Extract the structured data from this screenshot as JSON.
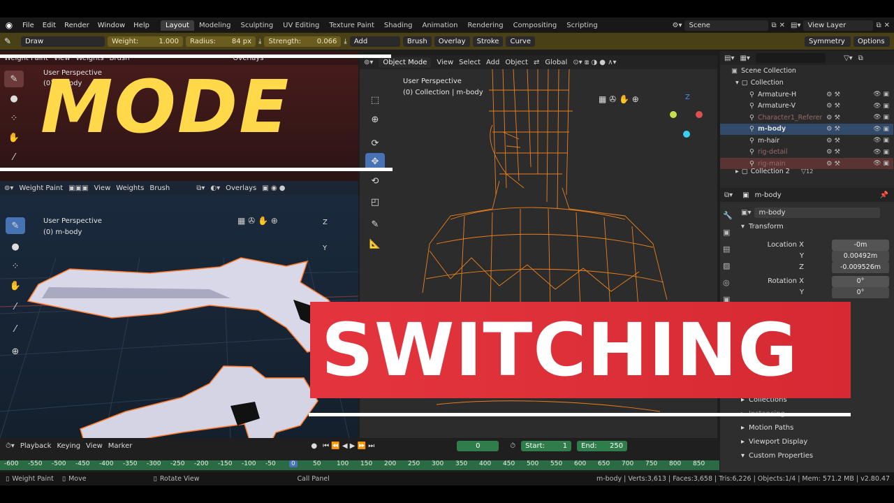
{
  "menu": {
    "items": [
      "File",
      "Edit",
      "Render",
      "Window",
      "Help"
    ],
    "workspaces": [
      "Layout",
      "Modeling",
      "Sculpting",
      "UV Editing",
      "Texture Paint",
      "Shading",
      "Animation",
      "Rendering",
      "Compositing",
      "Scripting"
    ],
    "active_workspace": "Layout",
    "scene": "Scene",
    "view_layer": "View Layer"
  },
  "tool_header": {
    "brush": "Draw",
    "weight_label": "Weight:",
    "weight_value": "1.000",
    "radius_label": "Radius:",
    "radius_value": "84 px",
    "strength_label": "Strength:",
    "strength_value": "0.066",
    "blend": "Add",
    "brush_menu": "Brush",
    "overlay_menu": "Overlay",
    "stroke_menu": "Stroke",
    "curve_menu": "Curve",
    "symmetry": "Symmetry",
    "options": "Options"
  },
  "viewport_top_left": {
    "mode": "Weight Paint",
    "menus": [
      "View",
      "Weights",
      "Brush"
    ],
    "overlays": "Overlays",
    "perspective": "User Perspective",
    "collection": "(0) m-body"
  },
  "viewport_bottom_left": {
    "mode": "Weight Paint",
    "menus": [
      "View",
      "Weights",
      "Brush"
    ],
    "overlays": "Overlays",
    "perspective": "User Perspective",
    "collection": "(0) m-body"
  },
  "viewport_center": {
    "mode": "Object Mode",
    "menus": [
      "View",
      "Select",
      "Add",
      "Object"
    ],
    "orientation": "Global",
    "perspective": "User Perspective",
    "collection": "(0) Collection | m-body"
  },
  "gizmo": {
    "z": "Z",
    "y": "Y"
  },
  "outliner": {
    "search_placeholder": "",
    "scene_collection": "Scene Collection",
    "collection": "Collection",
    "items": [
      {
        "name": "Armature-H",
        "selected": false,
        "dim": false
      },
      {
        "name": "Armature-V",
        "selected": false,
        "dim": false
      },
      {
        "name": "Character1_Reference",
        "selected": false,
        "dim": true
      },
      {
        "name": "m-body",
        "selected": true,
        "dim": false
      },
      {
        "name": "m-hair",
        "selected": false,
        "dim": false
      },
      {
        "name": "rig-detail",
        "selected": false,
        "dim": true
      },
      {
        "name": "rig-main",
        "selected": false,
        "dim": true
      }
    ],
    "collection2": "Collection 2",
    "collection2_count": "12"
  },
  "properties": {
    "object_name": "m-body",
    "data_name": "m-body",
    "transform_label": "Transform",
    "location_label": "Location X",
    "location": [
      "-0m",
      "0.00492m",
      "-0.009526m"
    ],
    "axis_y": "Y",
    "axis_z": "Z",
    "rotation_label": "Rotation X",
    "rotation": [
      "0°",
      "0°"
    ],
    "panels": [
      "Collections",
      "Instancing",
      "Motion Paths",
      "Viewport Display",
      "Custom Properties"
    ]
  },
  "timeline": {
    "menus": [
      "Playback",
      "Keying",
      "View",
      "Marker"
    ],
    "current_frame": "0",
    "start_label": "Start:",
    "start": "1",
    "end_label": "End:",
    "end": "250",
    "ruler": [
      "-600",
      "-550",
      "-500",
      "-450",
      "-400",
      "-350",
      "-300",
      "-250",
      "-200",
      "-150",
      "-100",
      "-50",
      "0",
      "50",
      "100",
      "150",
      "200",
      "250",
      "300",
      "350",
      "400",
      "450",
      "500",
      "550",
      "600",
      "650",
      "700",
      "750",
      "800",
      "850"
    ]
  },
  "status": {
    "mode": "Weight Paint",
    "move": "Move",
    "rotate": "Rotate View",
    "panel": "Call Panel",
    "stats": "m-body | Verts:3,613 | Faces:3,658 | Tris:6,226 | Objects:1/4 | Mem: 571.2 MB | v2.80.47"
  },
  "overlay": {
    "title1": "MODE",
    "title2": "SWITCHING"
  },
  "colors": {
    "accent_blue": "#4772b3",
    "mode_yellow": "#ffd94a",
    "banner_red": "#e0323a",
    "wire_orange": "#ff8a1c",
    "timeline_green": "#2e7d4a"
  }
}
